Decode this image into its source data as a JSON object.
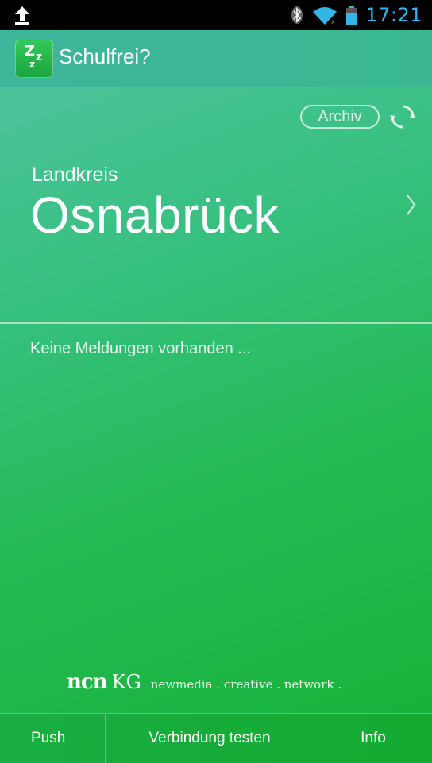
{
  "status_bar": {
    "time": "17:21",
    "icons": [
      "upload-icon",
      "bluetooth-icon",
      "wifi-icon",
      "signal-icon",
      "battery-icon"
    ],
    "accent": "#33b5e5"
  },
  "action_bar": {
    "title": "Schulfrei?",
    "app_icon": "zzz-sleep-icon"
  },
  "main": {
    "archive_button": "Archiv",
    "district_label": "Landkreis",
    "district_name": "Osnabrück",
    "empty_message": "Keine Meldungen vorhanden ...",
    "brand": {
      "ncn": "ncn",
      "kg": "KG",
      "tagline": "newmedia . creative . network ."
    }
  },
  "bottom_bar": {
    "push": "Push",
    "test_connection": "Verbindung testen",
    "info": "Info"
  },
  "colors": {
    "background_top": "#4cc39b",
    "background_bottom": "#17b23a"
  }
}
